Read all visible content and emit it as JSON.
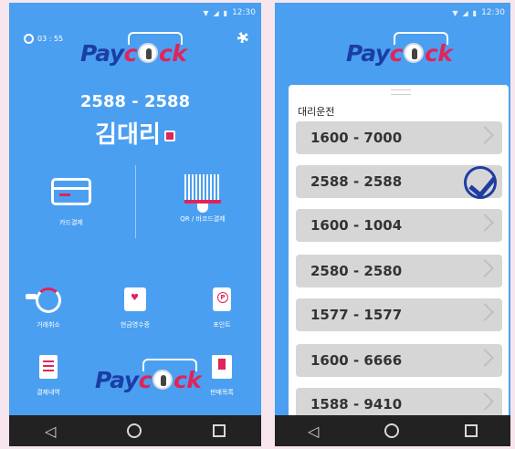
{
  "home": {
    "status_time": "12:30",
    "timer_text": "03 : 55",
    "logo": {
      "pay": "Pay",
      "c": "c",
      "ck": "ck"
    },
    "number": "2588 - 2588",
    "name": "김대리",
    "features_top": [
      {
        "label": "카드결제",
        "icon": "credit-card-icon"
      },
      {
        "label": "QR / 바코드결제",
        "icon": "barcode-scanner-icon"
      }
    ],
    "features_bottom": [
      {
        "label": "거래취소",
        "icon": "refund-icon"
      },
      {
        "label": "현금영수증",
        "icon": "receipt-icon"
      },
      {
        "label": "포인트",
        "icon": "point-icon"
      },
      {
        "label": "결제내역",
        "icon": "history-icon"
      },
      {
        "label": "판매목록",
        "icon": "bookmark-icon"
      }
    ],
    "bottom_logo": {
      "pay": "Pay",
      "c": "c",
      "ck": "ck"
    }
  },
  "list_screen": {
    "status_time": "12:30",
    "logo": {
      "pay": "Pay",
      "c": "c",
      "ck": "ck"
    },
    "title": "대리운전",
    "items": [
      {
        "number": "1600 - 7000",
        "selected": false
      },
      {
        "number": "2588 - 2588",
        "selected": true
      },
      {
        "number": "1600 - 1004",
        "selected": false
      },
      {
        "number": "2580 - 2580",
        "selected": false
      },
      {
        "number": "1577 - 1577",
        "selected": false
      },
      {
        "number": "1600 - 6666",
        "selected": false
      },
      {
        "number": "1588 - 9410",
        "selected": false
      }
    ]
  },
  "colors": {
    "background": "#4b9ff0",
    "accent": "#e0245a",
    "brand": "#1b3ea6"
  }
}
